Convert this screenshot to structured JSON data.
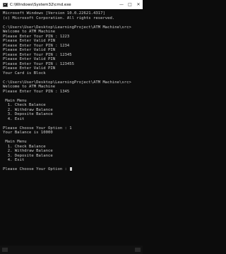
{
  "window": {
    "title": "C:\\Windows\\System32\\cmd.exe",
    "controls": {
      "minimize": "—",
      "maximize": "□",
      "close": "✕"
    }
  },
  "console": {
    "lines": [
      "Microsoft Windows [Version 10.0.22621.4317]",
      "(c) Microsoft Corporation. All rights reserved.",
      "",
      "C:\\Users\\User\\Desktop\\LearningProject\\ATM Machine\\src>",
      "Welcome to ATM Machine",
      "Please Enter Your PIN : 1223",
      "Please Enter Valid PIN",
      "Please Enter Your PIN : 1234",
      "Please Enter Valid PIN",
      "Please Enter Your PIN : 12345",
      "Please Enter Valid PIN",
      "Please Enter Your PIN : 123455",
      "Please Enter Valid PIN",
      "Your Card is Block",
      "",
      "C:\\Users\\User\\Desktop\\LearningProject\\ATM Machine\\src>",
      "Welcome to ATM Machine",
      "Please Enter Your PIN : 1345",
      "",
      " Main Menu",
      "  1. Check Balance",
      "  2. Withdraw Balance",
      "  3. Deposite Balance",
      "  4. Exit",
      "",
      "Please Choose Your Option : 1",
      "Your Balance is 10000",
      "",
      " Main Menu",
      "  1. Check Balance",
      "  2. Withdraw Balance",
      "  3. Deposite Balance",
      "  4. Exit",
      "",
      "Please Choose Your Option : "
    ]
  }
}
